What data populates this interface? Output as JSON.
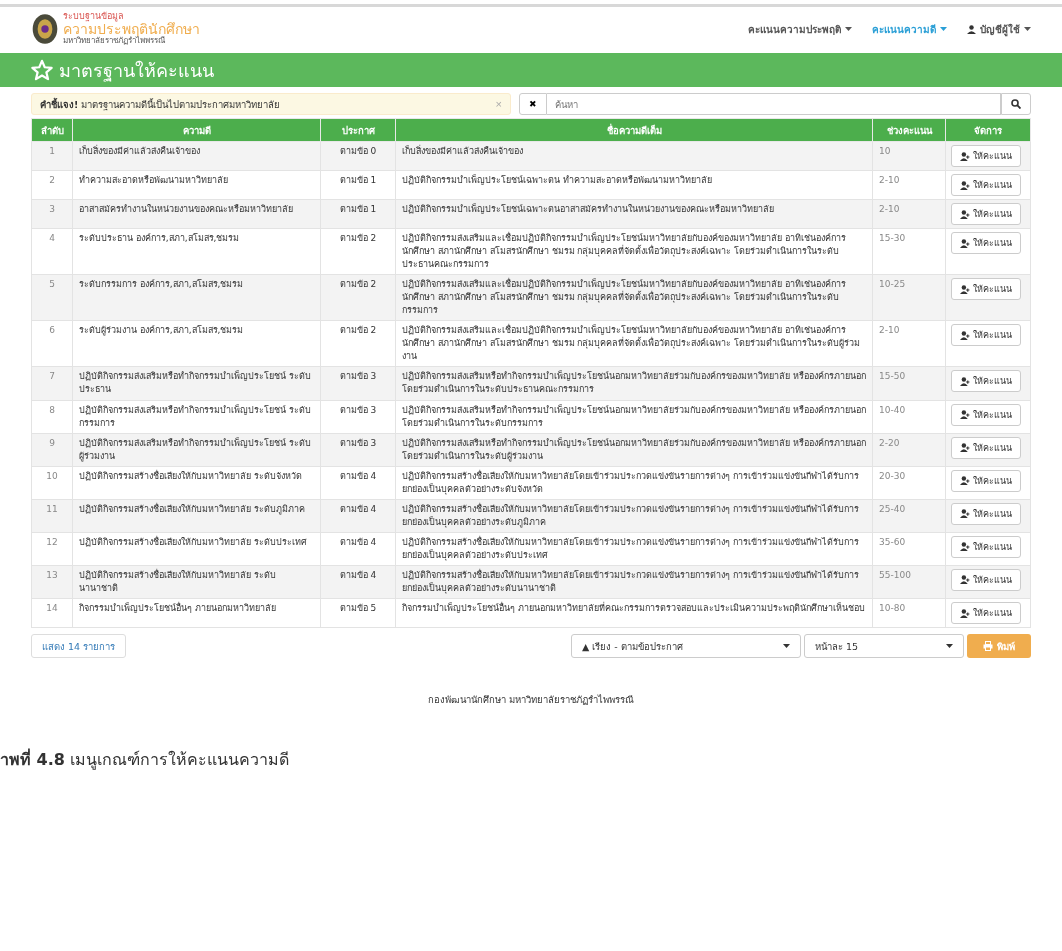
{
  "brand": {
    "line_1": "ระบบฐานข้อมูล",
    "line_2": "ความประพฤตินักศึกษา",
    "line_3": "มหาวิทยาลัยราชภัฏรำไพพรรณี"
  },
  "nav": [
    {
      "label": "คะแนนความประพฤติ",
      "selected": false
    },
    {
      "label": "คะแนนความดี",
      "selected": true
    },
    {
      "label": "บัญชีผู้ใช้",
      "selected": false
    }
  ],
  "page_title": "มาตรฐานให้คะแนน",
  "alert": {
    "text": "**คำชี้แจง!** มาตรฐานความดีนี้เป็นไปตามประกาศมหาวิทยาลัย",
    "close": "×"
  },
  "search": {
    "clear": "✖",
    "placeholder": "ค้นหา"
  },
  "table": {
    "columns": [
      "ลำดับ",
      "ความดี",
      "ประกาศ",
      "ชื่อความดีเต็ม",
      "ช่วงคะแนน",
      "จัดการ"
    ],
    "rows": [
      {
        "no": "1",
        "name": "เก็บสิ่งของมีค่าแล้วส่งคืนเจ้าของ",
        "clause": "ตามข้อ 0",
        "full": "เก็บสิ่งของมีค่าแล้วส่งคืนเจ้าของ",
        "range": "10",
        "action": "ให้คะแนน"
      },
      {
        "no": "2",
        "name": "ทำความสะอาดหรือพัฒนามหาวิทยาลัย",
        "clause": "ตามข้อ 1",
        "full": "ปฏิบัติกิจกรรมบำเพ็ญประโยชน์เฉพาะตน ทำความสะอาดหรือพัฒนามหาวิทยาลัย",
        "range": "2-10",
        "action": "ให้คะแนน"
      },
      {
        "no": "3",
        "name": "อาสาสมัครทำงานในหน่วยงานของคณะหรือมหาวิทยาลัย",
        "clause": "ตามข้อ 1",
        "full": "ปฏิบัติกิจกรรมบำเพ็ญประโยชน์เฉพาะตนอาสาสมัครทำงานในหน่วยงานของคณะหรือมหาวิทยาลัย",
        "range": "2-10",
        "action": "ให้คะแนน"
      },
      {
        "no": "4",
        "name": "ระดับประธาน องค์การ,สภา,สโมสร,ชมรม",
        "clause": "ตามข้อ 2",
        "full": "ปฏิบัติกิจกรรมส่งเสริมและเชื่อมปฏิบัติกิจกรรมบำเพ็ญประโยชน์มหาวิทยาลัยกับองค์ของมหาวิทยาลัย อาทิเช่นองค์การนักศึกษา สภานักศึกษา สโมสรนักศึกษา ชมรม กลุ่มบุคคลที่จัดตั้งเพื่อวัตถุประสงค์เฉพาะ โดยร่วมดำเนินการในระดับประธานคณะกรรมการ",
        "range": "15-30",
        "action": "ให้คะแนน"
      },
      {
        "no": "5",
        "name": "ระดับกรรมการ องค์การ,สภา,สโมสร,ชมรม",
        "clause": "ตามข้อ 2",
        "full": "ปฏิบัติกิจกรรมส่งเสริมและเชื่อมปฏิบัติกิจกรรมบำเพ็ญประโยชน์มหาวิทยาลัยกับองค์ของมหาวิทยาลัย อาทิเช่นองค์การนักศึกษา สภานักศึกษา สโมสรนักศึกษา ชมรม กลุ่มบุคคลที่จัดตั้งเพื่อวัตถุประสงค์เฉพาะ โดยร่วมดำเนินการในระดับกรรมการ",
        "range": "10-25",
        "action": "ให้คะแนน"
      },
      {
        "no": "6",
        "name": "ระดับผู้ร่วมงาน องค์การ,สภา,สโมสร,ชมรม",
        "clause": "ตามข้อ 2",
        "full": "ปฏิบัติกิจกรรมส่งเสริมและเชื่อมปฏิบัติกิจกรรมบำเพ็ญประโยชน์มหาวิทยาลัยกับองค์ของมหาวิทยาลัย อาทิเช่นองค์การนักศึกษา สภานักศึกษา สโมสรนักศึกษา ชมรม กลุ่มบุคคลที่จัดตั้งเพื่อวัตถุประสงค์เฉพาะ โดยร่วมดำเนินการในระดับผู้ร่วมงาน",
        "range": "2-10",
        "action": "ให้คะแนน"
      },
      {
        "no": "7",
        "name": "ปฏิบัติกิจกรรมส่งเสริมหรือทำกิจกรรมบำเพ็ญประโยชน์ ระดับประธาน",
        "clause": "ตามข้อ 3",
        "full": "ปฏิบัติกิจกรรมส่งเสริมหรือทำกิจกรรมบำเพ็ญประโยชน์นอกมหาวิทยาลัยร่วมกับองค์กรของมหาวิทยาลัย หรือองค์กรภายนอก โดยร่วมดำเนินการในระดับประธานคณะกรรมการ",
        "range": "15-50",
        "action": "ให้คะแนน"
      },
      {
        "no": "8",
        "name": "ปฏิบัติกิจกรรมส่งเสริมหรือทำกิจกรรมบำเพ็ญประโยชน์ ระดับกรรมการ",
        "clause": "ตามข้อ 3",
        "full": "ปฏิบัติกิจกรรมส่งเสริมหรือทำกิจกรรมบำเพ็ญประโยชน์นอกมหาวิทยาลัยร่วมกับองค์กรของมหาวิทยาลัย หรือองค์กรภายนอก โดยร่วมดำเนินการในระดับกรรมการ",
        "range": "10-40",
        "action": "ให้คะแนน"
      },
      {
        "no": "9",
        "name": "ปฏิบัติกิจกรรมส่งเสริมหรือทำกิจกรรมบำเพ็ญประโยชน์ ระดับผู้ร่วมงาน",
        "clause": "ตามข้อ 3",
        "full": "ปฏิบัติกิจกรรมส่งเสริมหรือทำกิจกรรมบำเพ็ญประโยชน์นอกมหาวิทยาลัยร่วมกับองค์กรของมหาวิทยาลัย หรือองค์กรภายนอก โดยร่วมดำเนินการในระดับผู้ร่วมงาน",
        "range": "2-20",
        "action": "ให้คะแนน"
      },
      {
        "no": "10",
        "name": "ปฏิบัติกิจกรรมสร้างชื่อเสียงให้กับมหาวิทยาลัย ระดับจังหวัด",
        "clause": "ตามข้อ 4",
        "full": "ปฏิบัติกิจกรรมสร้างชื่อเสียงให้กับมหาวิทยาลัยโดยเข้าร่วมประกวดแข่งขันรายการต่างๆ การเข้าร่วมแข่งขันกีฬาได้รับการยกย่องเป็นบุคคลตัวอย่างระดับจังหวัด",
        "range": "20-30",
        "action": "ให้คะแนน"
      },
      {
        "no": "11",
        "name": "ปฏิบัติกิจกรรมสร้างชื่อเสียงให้กับมหาวิทยาลัย ระดับภูมิภาค",
        "clause": "ตามข้อ 4",
        "full": "ปฏิบัติกิจกรรมสร้างชื่อเสียงให้กับมหาวิทยาลัยโดยเข้าร่วมประกวดแข่งขันรายการต่างๆ การเข้าร่วมแข่งขันกีฬาได้รับการยกย่องเป็นบุคคลตัวอย่างระดับภูมิภาค",
        "range": "25-40",
        "action": "ให้คะแนน"
      },
      {
        "no": "12",
        "name": "ปฏิบัติกิจกรรมสร้างชื่อเสียงให้กับมหาวิทยาลัย ระดับประเทศ",
        "clause": "ตามข้อ 4",
        "full": "ปฏิบัติกิจกรรมสร้างชื่อเสียงให้กับมหาวิทยาลัยโดยเข้าร่วมประกวดแข่งขันรายการต่างๆ การเข้าร่วมแข่งขันกีฬาได้รับการยกย่องเป็นบุคคลตัวอย่างระดับประเทศ",
        "range": "35-60",
        "action": "ให้คะแนน"
      },
      {
        "no": "13",
        "name": "ปฏิบัติกิจกรรมสร้างชื่อเสียงให้กับมหาวิทยาลัย ระดับนานาชาติ",
        "clause": "ตามข้อ 4",
        "full": "ปฏิบัติกิจกรรมสร้างชื่อเสียงให้กับมหาวิทยาลัยโดยเข้าร่วมประกวดแข่งขันรายการต่างๆ การเข้าร่วมแข่งขันกีฬาได้รับการยกย่องเป็นบุคคลตัวอย่างระดับนานาชาติ",
        "range": "55-100",
        "action": "ให้คะแนน"
      },
      {
        "no": "14",
        "name": "กิจกรรมบำเพ็ญประโยชน์อื่นๆ ภายนอกมหาวิทยาลัย",
        "clause": "ตามข้อ 5",
        "full": "กิจกรรมบำเพ็ญประโยชน์อื่นๆ ภายนอกมหาวิทยาลัยที่คณะกรรมการตรวจสอบและประเมินความประพฤตินักศึกษาเห็นชอบ",
        "range": "10-80",
        "action": "ให้คะแนน"
      }
    ]
  },
  "footer_bar": {
    "count": "แสดง 14 รายการ",
    "sort": "▲ เรียง - ตามข้อประกาศ",
    "per_page": "หน้าละ 15",
    "print": "พิมพ์"
  },
  "footer": "กองพัฒนานักศึกษา มหาวิทยาลัยราชภัฏรำไพพรรณี",
  "caption": "**าพที่ 4.8** เมนูเกณฑ์การให้คะแนนความดี"
}
